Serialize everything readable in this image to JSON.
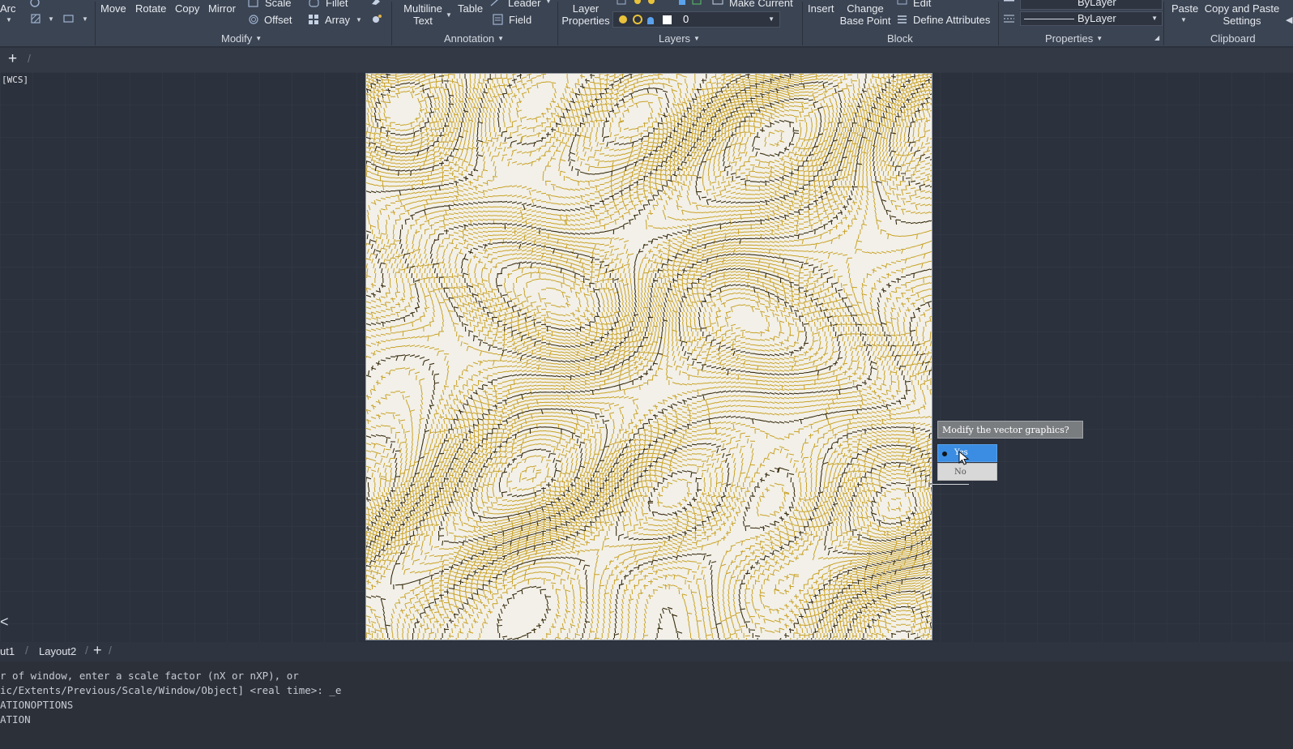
{
  "ribbon": {
    "draw_items": {
      "arc": "Arc"
    },
    "modify": {
      "move": "Move",
      "rotate": "Rotate",
      "copy": "Copy",
      "mirror": "Mirror",
      "scale": "Scale",
      "offset": "Offset",
      "fillet": "Fillet",
      "array": "Array",
      "panel_title": "Modify"
    },
    "annotation": {
      "multiline_text_line1": "Multiline",
      "multiline_text_line2": "Text",
      "table": "Table",
      "leader": "Leader",
      "field": "Field",
      "panel_title": "Annotation"
    },
    "layers": {
      "layer_properties_line1": "Layer",
      "layer_properties_line2": "Properties",
      "make_current": "Make Current",
      "current_layer": "0",
      "panel_title": "Layers"
    },
    "block": {
      "insert": "Insert",
      "change_base_point_line1": "Change",
      "change_base_point_line2": "Base Point",
      "edit": "Edit",
      "define_attributes": "Define Attributes",
      "panel_title": "Block"
    },
    "properties": {
      "lineweight": "ByLayer",
      "linetype": "ByLayer",
      "panel_title": "Properties"
    },
    "clipboard": {
      "paste": "Paste",
      "copy_paste_settings_line1": "Copy and Paste",
      "copy_paste_settings_line2": "Settings",
      "panel_title": "Clipboard"
    }
  },
  "file_tabs": {
    "new_tab": "+",
    "separator": "/"
  },
  "canvas": {
    "ucs_label": "[WCS]",
    "prompt": {
      "question": "Modify the vector graphics?",
      "option_yes": "Yes",
      "option_no": "No",
      "selected": "Yes"
    }
  },
  "layout_tabs": {
    "layout1": "ut1",
    "layout2": "Layout2",
    "add": "+"
  },
  "command_history": [
    "r of window, enter a scale factor (nX or nXP), or",
    "ic/Extents/Previous/Scale/Window/Object] <real time>: _e",
    "ATIONOPTIONS",
    "ATION"
  ],
  "colors": {
    "ribbon_bg": "#3b4453",
    "canvas_bg": "#2b313d",
    "contour_gold": "#c9a227",
    "contour_dark": "#3a2e12",
    "map_paper": "#f2f0e8",
    "selected_option": "#3a8de3"
  }
}
